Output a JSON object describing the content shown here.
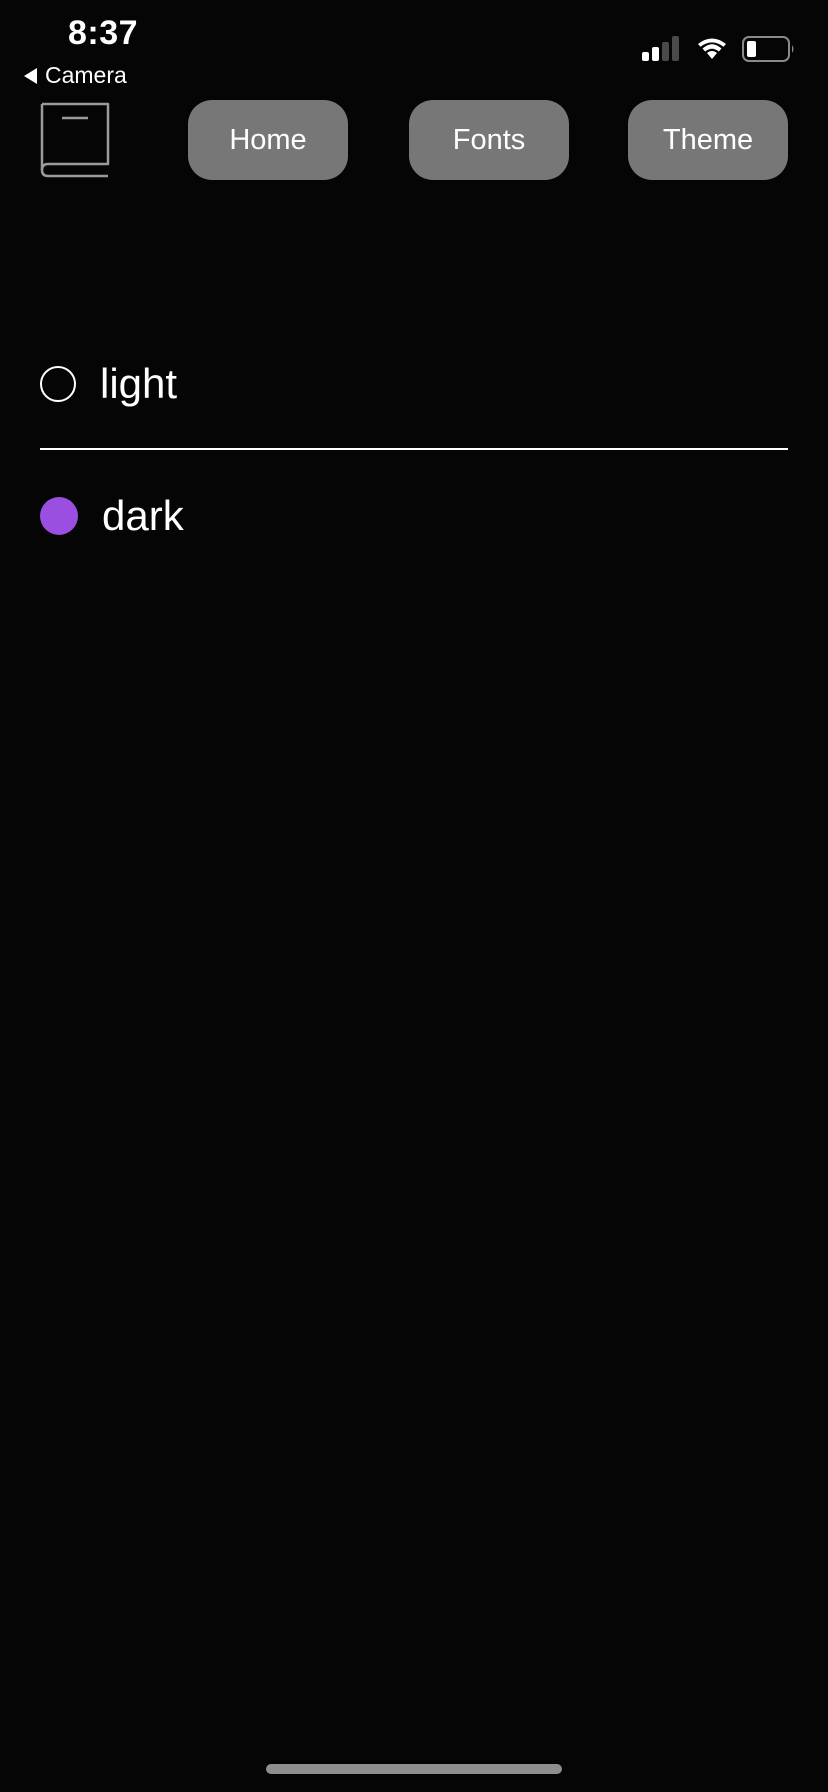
{
  "status_bar": {
    "time": "8:37",
    "back_label": "Camera",
    "signal_icon": "cellular-signal-icon",
    "wifi_icon": "wifi-icon",
    "battery_icon": "battery-icon"
  },
  "header": {
    "logo_icon": "book-icon",
    "nav": [
      {
        "label": "Home"
      },
      {
        "label": "Fonts"
      },
      {
        "label": "Theme"
      }
    ]
  },
  "theme_options": [
    {
      "label": "light",
      "selected": false
    },
    {
      "label": "dark",
      "selected": true
    }
  ],
  "colors": {
    "background": "#050505",
    "button": "#777777",
    "accent": "#9b4fe0",
    "text": "#ffffff"
  }
}
